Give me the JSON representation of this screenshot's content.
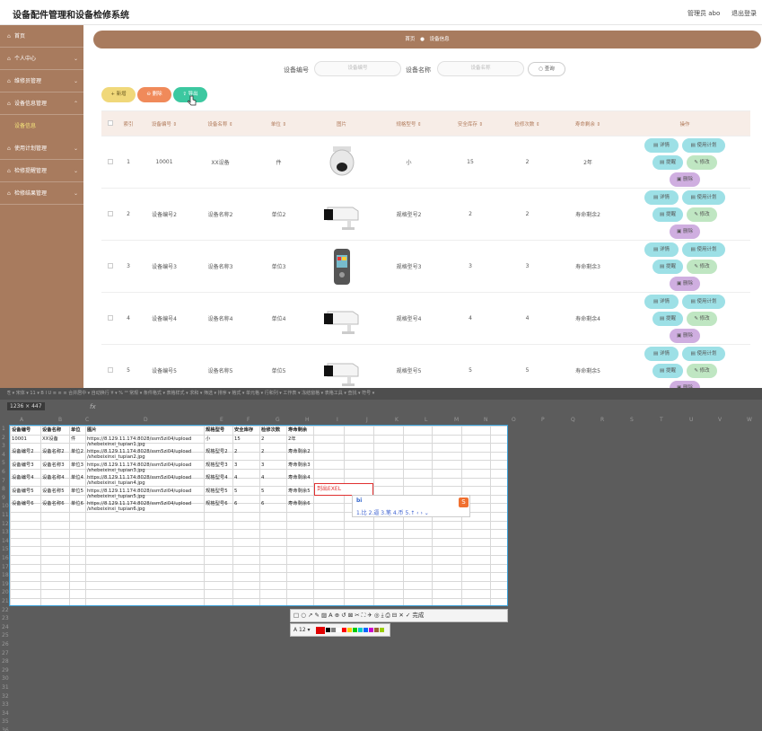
{
  "app": {
    "title": "设备配件管理和设备检修系统",
    "user": "管理员 abo",
    "logout": "退出登录"
  },
  "sidebar": {
    "items": [
      {
        "icon": "⌂",
        "label": "首页",
        "arrow": ""
      },
      {
        "icon": "⌂",
        "label": "个人中心",
        "arrow": "⌄"
      },
      {
        "icon": "⌂",
        "label": "维修员管理",
        "arrow": "⌄"
      },
      {
        "icon": "⌂",
        "label": "设备信息管理",
        "arrow": "⌃"
      },
      {
        "sub": true,
        "label": "设备信息"
      },
      {
        "icon": "⌂",
        "label": "使用计划管理",
        "arrow": "⌄"
      },
      {
        "icon": "⌂",
        "label": "检修提醒管理",
        "arrow": "⌄"
      },
      {
        "icon": "⌂",
        "label": "检修结果管理",
        "arrow": "⌄"
      }
    ]
  },
  "breadcrumb": {
    "home": "首页",
    "sep": "●",
    "current": "设备信息"
  },
  "search": {
    "label1": "设备编号",
    "ph1": "设备编号",
    "label2": "设备名称",
    "ph2": "设备名称",
    "button": "○ 查询"
  },
  "actions": {
    "add": "+ 新增",
    "del": "⊖ 删除",
    "export": "⇪ 导出"
  },
  "table": {
    "headers": [
      "",
      "索引",
      "设备编号 ⇕",
      "设备名称 ⇕",
      "单位 ⇕",
      "图片",
      "规格型号 ⇕",
      "安全库存 ⇕",
      "检修次数 ⇕",
      "寿命剩余 ⇕",
      "操作"
    ],
    "ops": {
      "detail": "▤ 详情",
      "plan": "▤ 使用计划",
      "remind": "▤ 提醒",
      "edit": "✎ 修改",
      "delete": "▣ 删除"
    },
    "rows": [
      {
        "idx": "1",
        "code": "10001",
        "name": "XX设备",
        "unit": "件",
        "img": "dome",
        "spec": "小",
        "stock": "15",
        "times": "2",
        "life": "2年"
      },
      {
        "idx": "2",
        "code": "设备编号2",
        "name": "设备名称2",
        "unit": "单位2",
        "img": "bullet",
        "spec": "规格型号2",
        "stock": "2",
        "times": "2",
        "life": "寿命剩余2"
      },
      {
        "idx": "3",
        "code": "设备编号3",
        "name": "设备名称3",
        "unit": "单位3",
        "img": "handheld",
        "spec": "规格型号3",
        "stock": "3",
        "times": "3",
        "life": "寿命剩余3"
      },
      {
        "idx": "4",
        "code": "设备编号4",
        "name": "设备名称4",
        "unit": "单位4",
        "img": "bullet",
        "spec": "规格型号4",
        "stock": "4",
        "times": "4",
        "life": "寿命剩余4"
      },
      {
        "idx": "5",
        "code": "设备编号5",
        "name": "设备名称5",
        "unit": "单位5",
        "img": "bullet",
        "spec": "规格型号5",
        "stock": "5",
        "times": "5",
        "life": "寿命剩余5"
      }
    ]
  },
  "sheet": {
    "toolbar": "⎘ ▾ 宋体 ▾ 11 ▾  B I U  ≡ ≡ ≡  合并居中 ▾  自动换行  ¥ ▾ % ⁰⁰  常规 ▾  条件格式 ▾  表格样式 ▾  求和 ▾  筛选 ▾  排序 ▾  格式 ▾  单元格 ▾  行和列 ▾  工作表 ▾  冻结窗格 ▾  表格工具 ▾  查找 ▾  符号 ▾",
    "namebox": "1236 × 447",
    "fx": "fx",
    "col_letters": [
      "A",
      "B",
      "C",
      "D",
      "E",
      "F",
      "G",
      "H",
      "I",
      "J",
      "K",
      "L",
      "M",
      "N",
      "O",
      "P",
      "Q",
      "R",
      "S",
      "T",
      "U",
      "V",
      "W"
    ],
    "headers": [
      "设备编号",
      "设备名称",
      "单位",
      "图片",
      "规格型号",
      "安全库存",
      "检修次数",
      "寿命剩余"
    ],
    "rows": [
      [
        "10001",
        "XX设备",
        "件",
        "https://8.129.11.174:8028/ssm5zi04/upload",
        "/shebeixinxi_tupian1.jpg",
        "小",
        "15",
        "2",
        "2年"
      ],
      [
        "设备编号2",
        "设备名称2",
        "单位2",
        "https://8.129.11.174:8028/ssm5zi04/upload",
        "/shebeixinxi_tupian2.jpg",
        "规格型号2",
        "2",
        "2",
        "寿命剩余2"
      ],
      [
        "设备编号3",
        "设备名称3",
        "单位3",
        "https://8.129.11.174:8028/ssm5zi04/upload",
        "/shebeixinxi_tupian3.jpg",
        "规格型号3",
        "3",
        "3",
        "寿命剩余3"
      ],
      [
        "设备编号4",
        "设备名称4",
        "单位4",
        "https://8.129.11.174:8028/ssm5zi04/upload",
        "/shebeixinxi_tupian4.jpg",
        "规格型号4",
        "4",
        "4",
        "寿命剩余4"
      ],
      [
        "设备编号5",
        "设备名称5",
        "单位5",
        "https://8.129.11.174:8028/ssm5zi04/upload",
        "/shebeixinxi_tupian5.jpg",
        "规格型号5",
        "5",
        "5",
        "寿命剩余5"
      ],
      [
        "设备编号6",
        "设备名称6",
        "单位6",
        "https://8.129.11.174:8028/ssm5zi04/upload",
        "/shebeixinxi_tupian6.jpg",
        "规格型号6",
        "6",
        "6",
        "寿命剩余6"
      ]
    ],
    "annotation": "到出EXEL",
    "ime_input": "bi",
    "ime_candidates": "1.比  2.逼  3.笔  4.币  5.↑   ‹ › ⌄",
    "ime_logo": "S",
    "shot_tools": "□ ○ ↗ ✎ ▨ A ⊕ ↺ ⊠ ✂ ⛶ ✈ ◎ ⤓ ⎙ ⊟ ✕ ✓ 完成",
    "font_size": "A  12 ▾",
    "swatches": [
      "#e00000",
      "#000000",
      "#808080",
      "#ffffff",
      "#ff0000",
      "#ffcc00",
      "#00cc00",
      "#00cccc",
      "#0066ff",
      "#cc00cc",
      "#996633",
      "#99cc00"
    ]
  }
}
